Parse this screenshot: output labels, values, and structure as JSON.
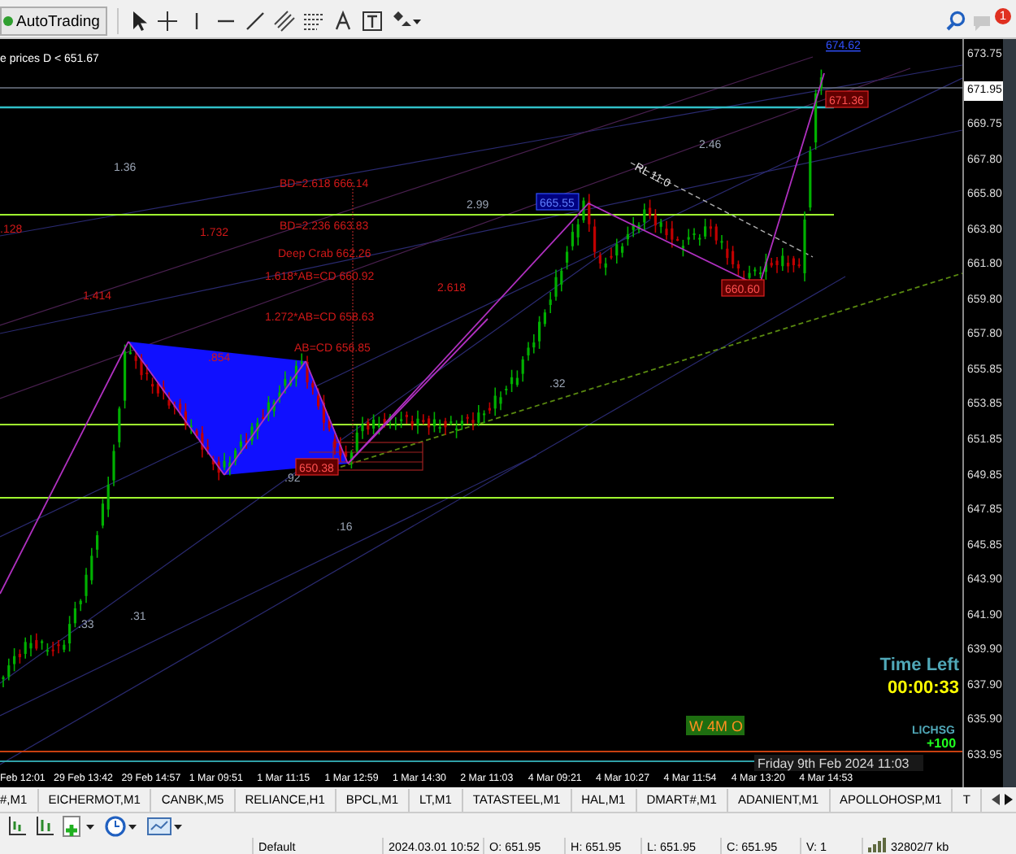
{
  "toolbar": {
    "autotrading": "AutoTrading",
    "notifications": "1"
  },
  "chart": {
    "info": "e prices D < 651.67",
    "labels": [
      {
        "text": "674.62",
        "kind": "link"
      },
      {
        "text": "671.36",
        "kind": "tag_red"
      },
      {
        "text": "1.36",
        "kind": "fib"
      },
      {
        "text": "BD=2.618  666.14",
        "kind": "level"
      },
      {
        "text": ".128",
        "kind": "level"
      },
      {
        "text": "1.732",
        "kind": "level"
      },
      {
        "text": "BD=2.236  663.83",
        "kind": "level"
      },
      {
        "text": "2.99",
        "kind": "fib"
      },
      {
        "text": "665.55",
        "kind": "tag_blue"
      },
      {
        "text": "Deep Crab  662.26",
        "kind": "level"
      },
      {
        "text": "1.618*AB=CD  660.92",
        "kind": "level"
      },
      {
        "text": "2.618",
        "kind": "level"
      },
      {
        "text": "1.414",
        "kind": "level"
      },
      {
        "text": "1.272*AB=CD  658.63",
        "kind": "level"
      },
      {
        "text": "AB=CD  656.85",
        "kind": "level"
      },
      {
        "text": ".854",
        "kind": "level"
      },
      {
        "text": "2.46",
        "kind": "fib"
      },
      {
        "text": "RL 11.0",
        "kind": "trend"
      },
      {
        "text": "660.60",
        "kind": "tag_red"
      },
      {
        "text": ".92",
        "kind": "fib"
      },
      {
        "text": "650.38",
        "kind": "tag_red"
      },
      {
        "text": ".32",
        "kind": "fib"
      },
      {
        "text": ".16",
        "kind": "fib"
      },
      {
        "text": ".33",
        "kind": "fib"
      },
      {
        "text": ".31",
        "kind": "fib"
      }
    ],
    "time_left": {
      "label": "Time Left",
      "countdown": "00:00:33"
    },
    "signal_badge": "W 4M O",
    "symbol": "LICHSG",
    "change": "+100",
    "date": "Friday 9th Feb 2024 11:03",
    "price_axis": [
      {
        "label": "673.75",
        "current": false
      },
      {
        "label": "671.95",
        "current": true
      },
      {
        "label": "669.75",
        "current": false
      },
      {
        "label": "667.80",
        "current": false
      },
      {
        "label": "665.80",
        "current": false
      },
      {
        "label": "663.80",
        "current": false
      },
      {
        "label": "661.80",
        "current": false
      },
      {
        "label": "659.80",
        "current": false
      },
      {
        "label": "657.80",
        "current": false
      },
      {
        "label": "655.85",
        "current": false
      },
      {
        "label": "653.85",
        "current": false
      },
      {
        "label": "651.85",
        "current": false
      },
      {
        "label": "649.85",
        "current": false
      },
      {
        "label": "647.85",
        "current": false
      },
      {
        "label": "645.85",
        "current": false
      },
      {
        "label": "643.90",
        "current": false
      },
      {
        "label": "641.90",
        "current": false
      },
      {
        "label": "639.90",
        "current": false
      },
      {
        "label": "637.90",
        "current": false
      },
      {
        "label": "635.90",
        "current": false
      },
      {
        "label": "633.95",
        "current": false
      }
    ],
    "time_axis": [
      "Feb 12:01",
      "29 Feb 13:42",
      "29 Feb 14:57",
      "1 Mar 09:51",
      "1 Mar 11:15",
      "1 Mar 12:59",
      "1 Mar 14:30",
      "2 Mar 11:03",
      "4 Mar 09:21",
      "4 Mar 10:27",
      "4 Mar 11:54",
      "4 Mar 13:20",
      "4 Mar 14:53"
    ]
  },
  "tabs": [
    {
      "label": "#,M1",
      "selected": false
    },
    {
      "label": "EICHERMOT,M1",
      "selected": false
    },
    {
      "label": "CANBK,M5",
      "selected": false
    },
    {
      "label": "RELIANCE,H1",
      "selected": false
    },
    {
      "label": "BPCL,M1",
      "selected": false
    },
    {
      "label": "LT,M1",
      "selected": false
    },
    {
      "label": "TATASTEEL,M1",
      "selected": false
    },
    {
      "label": "HAL,M1",
      "selected": false
    },
    {
      "label": "DMART#,M1",
      "selected": false
    },
    {
      "label": "ADANIENT,M1",
      "selected": false
    },
    {
      "label": "APOLLOHOSP,M1",
      "selected": false
    },
    {
      "label": "T",
      "selected": false
    }
  ],
  "status_bar": {
    "profile": "Default",
    "time": "2024.03.01 10:52",
    "open": "O: 651.95",
    "high": "H: 651.95",
    "low": "L: 651.95",
    "close": "C: 651.95",
    "volume": "V: 1",
    "traffic": "32802/7 kb"
  }
}
